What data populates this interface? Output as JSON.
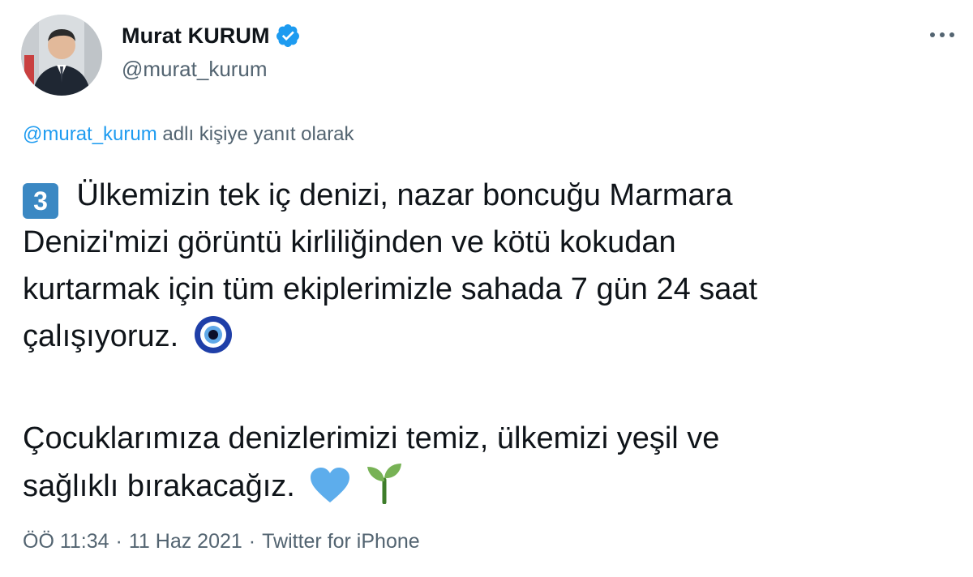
{
  "author": {
    "display_name": "Murat KURUM",
    "handle": "@murat_kurum",
    "verified_icon": "verified-badge-icon"
  },
  "reply": {
    "mention": "@murat_kurum",
    "text": " adlı kişiye yanıt olarak"
  },
  "tweet": {
    "keycap": "3",
    "paragraph1_line1": " Ülkemizin tek iç denizi, nazar boncuğu Marmara",
    "paragraph1_line2": "Denizi'mizi görüntü kirliliğinden ve kötü kokudan",
    "paragraph1_line3": "kurtarmak için tüm ekiplerimizle sahada 7 gün 24 saat",
    "paragraph1_line4": "çalışıyoruz.",
    "paragraph2_line1": "Çocuklarımıza denizlerimizi temiz, ülkemizi yeşil ve",
    "paragraph2_line2": "sağlıklı bırakacağız.",
    "emojis": [
      "nazar-amulet-icon",
      "blue-heart-icon",
      "seedling-icon"
    ]
  },
  "meta": {
    "time": "ÖÖ 11:34",
    "separator": "·",
    "date": "11 Haz 2021",
    "source": "Twitter for iPhone"
  },
  "colors": {
    "text": "#0f1419",
    "secondary": "#536471",
    "link": "#1d9bf0",
    "keycap": "#3b88c3"
  }
}
